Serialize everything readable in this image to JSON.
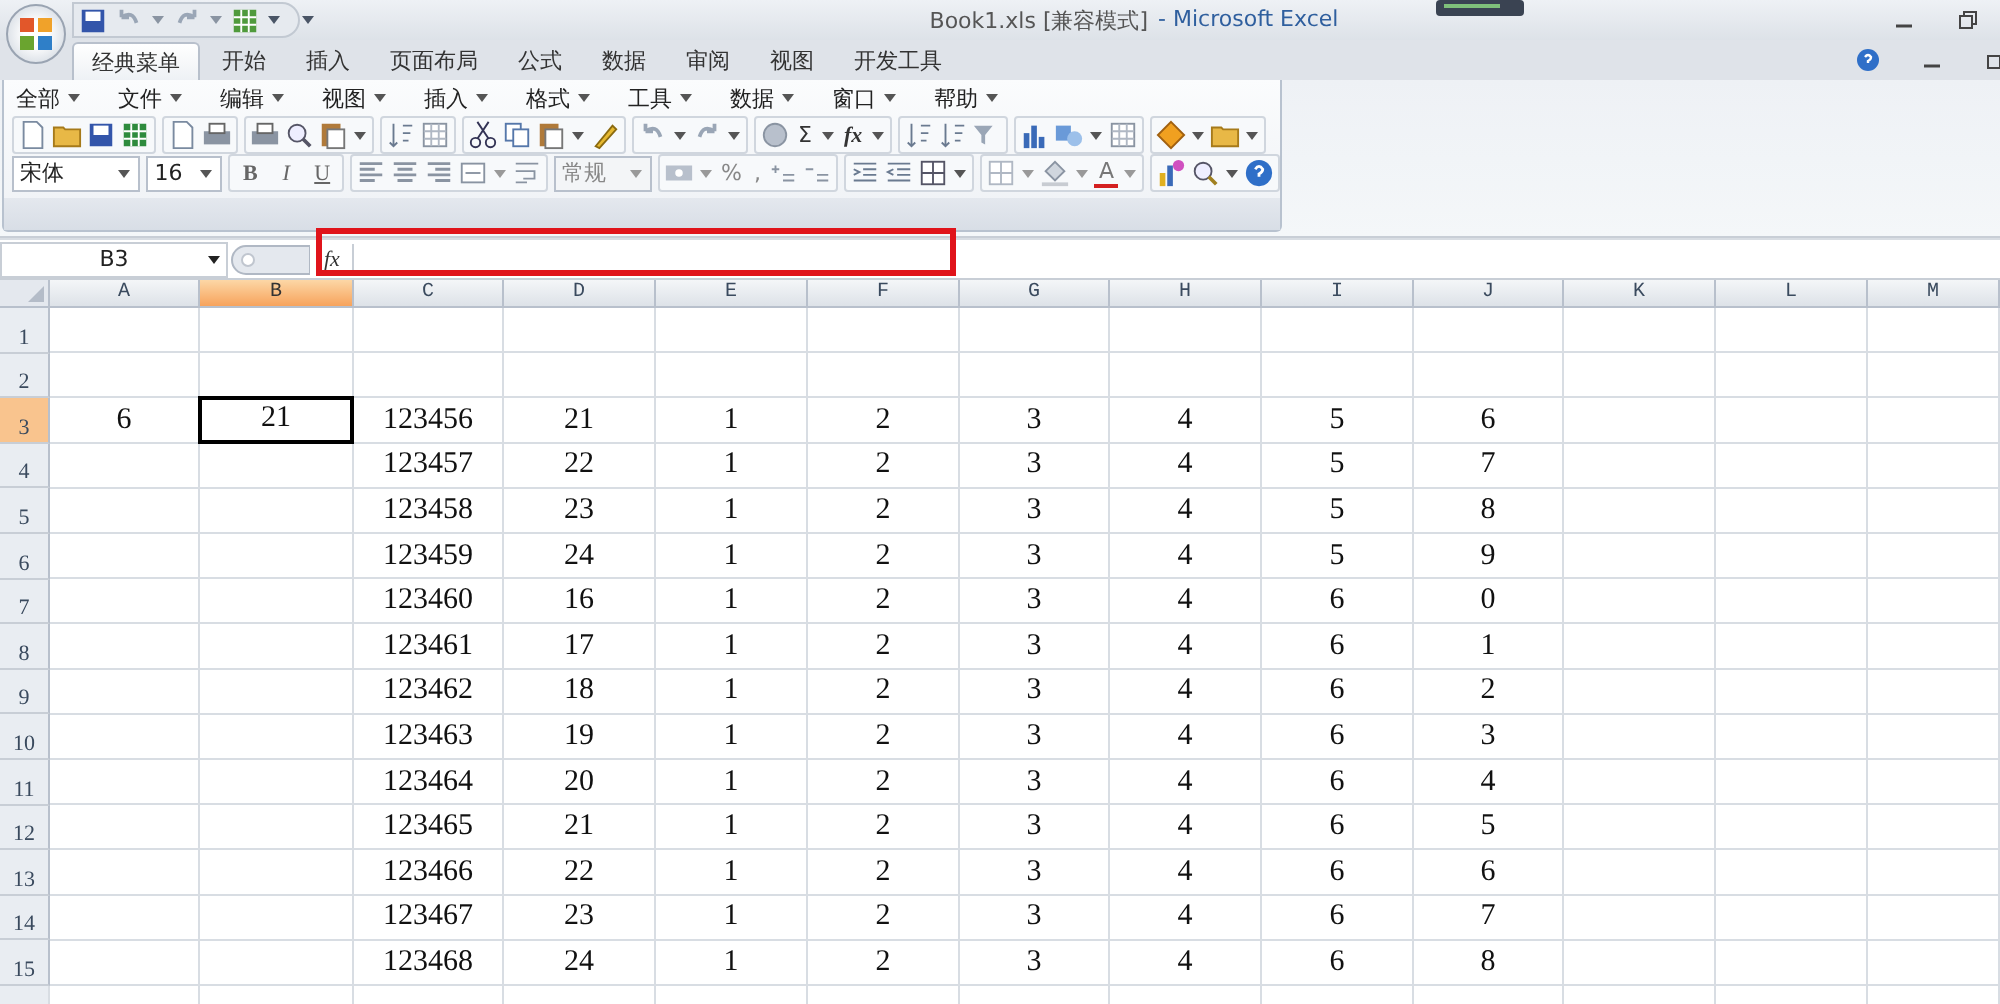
{
  "window": {
    "title_document": "Book1.xls  [兼容模式]",
    "title_app": "- Microsoft Excel"
  },
  "ribbon_tabs": [
    {
      "label": "经典菜单",
      "selected": true
    },
    {
      "label": "开始",
      "selected": false
    },
    {
      "label": "插入",
      "selected": false
    },
    {
      "label": "页面布局",
      "selected": false
    },
    {
      "label": "公式",
      "selected": false
    },
    {
      "label": "数据",
      "selected": false
    },
    {
      "label": "审阅",
      "selected": false
    },
    {
      "label": "视图",
      "selected": false
    },
    {
      "label": "开发工具",
      "selected": false
    }
  ],
  "menu": [
    "全部",
    "文件",
    "编辑",
    "视图",
    "插入",
    "格式",
    "工具",
    "数据",
    "窗口",
    "帮助"
  ],
  "toolbar": {
    "sum": "Σ",
    "function": "fx"
  },
  "format_bar": {
    "font": "宋体",
    "size": "16",
    "bold": "B",
    "italic": "I",
    "underline": "U",
    "number_format": "常规",
    "percent": "%",
    "comma": ",",
    "font_color": "A"
  },
  "formula_bar": {
    "name_box": "B3",
    "fx": "fx"
  },
  "sheet": {
    "columns": [
      {
        "label": "A",
        "selected": false
      },
      {
        "label": "B",
        "selected": true
      },
      {
        "label": "C",
        "selected": false
      },
      {
        "label": "D",
        "selected": false
      },
      {
        "label": "E",
        "selected": false
      },
      {
        "label": "F",
        "selected": false
      },
      {
        "label": "G",
        "selected": false
      },
      {
        "label": "H",
        "selected": false
      },
      {
        "label": "I",
        "selected": false
      },
      {
        "label": "J",
        "selected": false
      },
      {
        "label": "K",
        "selected": false
      },
      {
        "label": "L",
        "selected": false
      },
      {
        "label": "M",
        "selected": false
      }
    ],
    "rows": [
      {
        "number": "1",
        "selected": false,
        "cells": []
      },
      {
        "number": "2",
        "selected": false,
        "cells": []
      },
      {
        "number": "3",
        "selected": true,
        "cells": [
          "6",
          "21",
          "123456",
          "21",
          "1",
          "2",
          "3",
          "4",
          "5",
          "6"
        ]
      },
      {
        "number": "4",
        "selected": false,
        "cells": [
          null,
          null,
          "123457",
          "22",
          "1",
          "2",
          "3",
          "4",
          "5",
          "7"
        ]
      },
      {
        "number": "5",
        "selected": false,
        "cells": [
          null,
          null,
          "123458",
          "23",
          "1",
          "2",
          "3",
          "4",
          "5",
          "8"
        ]
      },
      {
        "number": "6",
        "selected": false,
        "cells": [
          null,
          null,
          "123459",
          "24",
          "1",
          "2",
          "3",
          "4",
          "5",
          "9"
        ]
      },
      {
        "number": "7",
        "selected": false,
        "cells": [
          null,
          null,
          "123460",
          "16",
          "1",
          "2",
          "3",
          "4",
          "6",
          "0"
        ]
      },
      {
        "number": "8",
        "selected": false,
        "cells": [
          null,
          null,
          "123461",
          "17",
          "1",
          "2",
          "3",
          "4",
          "6",
          "1"
        ]
      },
      {
        "number": "9",
        "selected": false,
        "cells": [
          null,
          null,
          "123462",
          "18",
          "1",
          "2",
          "3",
          "4",
          "6",
          "2"
        ]
      },
      {
        "number": "10",
        "selected": false,
        "cells": [
          null,
          null,
          "123463",
          "19",
          "1",
          "2",
          "3",
          "4",
          "6",
          "3"
        ]
      },
      {
        "number": "11",
        "selected": false,
        "cells": [
          null,
          null,
          "123464",
          "20",
          "1",
          "2",
          "3",
          "4",
          "6",
          "4"
        ]
      },
      {
        "number": "12",
        "selected": false,
        "cells": [
          null,
          null,
          "123465",
          "21",
          "1",
          "2",
          "3",
          "4",
          "6",
          "5"
        ]
      },
      {
        "number": "13",
        "selected": false,
        "cells": [
          null,
          null,
          "123466",
          "22",
          "1",
          "2",
          "3",
          "4",
          "6",
          "6"
        ]
      },
      {
        "number": "14",
        "selected": false,
        "cells": [
          null,
          null,
          "123467",
          "23",
          "1",
          "2",
          "3",
          "4",
          "6",
          "7"
        ]
      },
      {
        "number": "15",
        "selected": false,
        "cells": [
          null,
          null,
          "123468",
          "24",
          "1",
          "2",
          "3",
          "4",
          "6",
          "8"
        ]
      }
    ]
  }
}
